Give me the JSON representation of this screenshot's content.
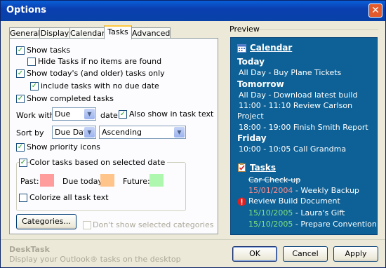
{
  "window": {
    "title": "Options",
    "close_glyph": "✕"
  },
  "tabs": [
    {
      "label": "General"
    },
    {
      "label": "Display"
    },
    {
      "label": "Calendar"
    },
    {
      "label": "Tasks"
    },
    {
      "label": "Advanced"
    }
  ],
  "tasks_tab": {
    "show_tasks": "Show tasks",
    "hide_if_none": "Hide Tasks if no items are found",
    "show_today_older": "Show today's (and older) tasks only",
    "include_no_due": "include tasks with no due date",
    "show_completed": "Show completed tasks",
    "work_with_label": "Work with:",
    "work_with_value": "Due",
    "date_label": "date",
    "also_show_label": "Also show in task text",
    "sort_by_label": "Sort by",
    "sort_by_value": "Due Date",
    "sort_order_value": "Ascending",
    "show_priority": "Show priority icons",
    "color_tasks": "Color tasks based on selected date",
    "past_label": "Past:",
    "due_today_label": "Due today:",
    "future_label": "Future:",
    "colorize_all": "Colorize all task text",
    "categories_button": "Categories...",
    "dont_show_categories": "Don't show selected categories"
  },
  "colors": {
    "past": "#ff9c9c",
    "due_today": "#ffc48a",
    "future": "#aef7ae"
  },
  "preview": {
    "label": "Preview",
    "calendar_title": "Calendar",
    "today": "Today",
    "today_event_time": "All Day",
    "today_event_text": "- Buy Plane Tickets",
    "tomorrow": "Tomorrow",
    "tom_1_time": "All Day",
    "tom_1_text": "- Download latest build",
    "tom_2": "11:00 - 11:10 Review Carlson",
    "tom_2_cont": "Project",
    "tom_3": "18:00 - 19:00 Finish Smith Report",
    "friday": "Friday",
    "fri_1": "10:00 - 10:05 Call Grandma",
    "tasks_title": "Tasks",
    "task_done": "Car Check-up",
    "task_2_date": "15/01/2004",
    "task_2_text": "- Weekly Backup",
    "task_3_text": "Review Build Document",
    "task_4_date": "15/10/2005",
    "task_4_text": "- Laura's Gift",
    "task_5_date": "15/10/2005",
    "task_5_text": "- Prepare Convention"
  },
  "footer": {
    "app_name": "DeskTask",
    "description": "Display your Outlook® tasks on the desktop",
    "ok": "OK",
    "cancel": "Cancel",
    "apply": "Apply"
  }
}
